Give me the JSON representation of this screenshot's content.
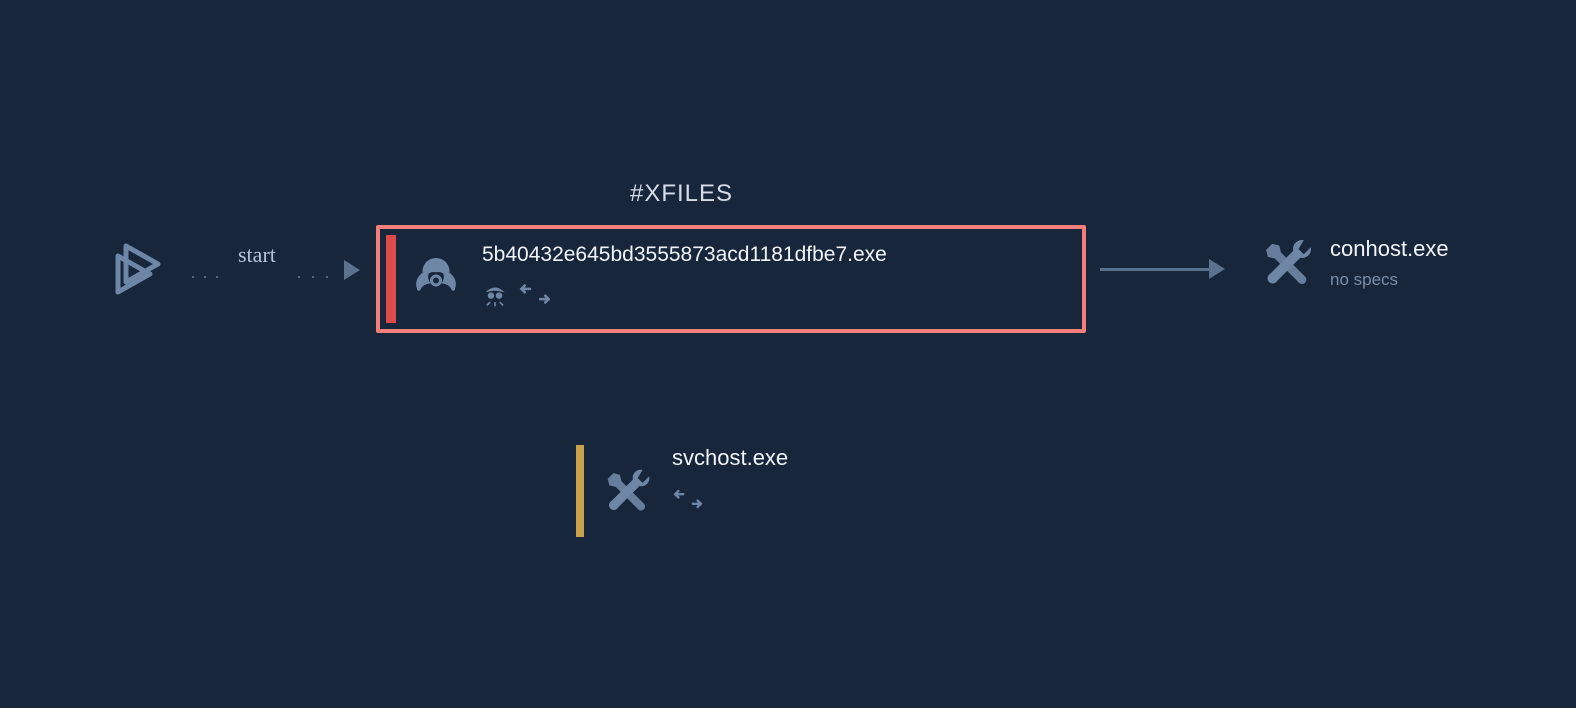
{
  "start": {
    "label": "start"
  },
  "nodes": {
    "main": {
      "tag": "#XFILES",
      "title": "5b40432e645bd3555873acd1181dfbe7.exe",
      "icon": "biohazard-icon",
      "indicators": [
        "stealth-icon",
        "network-icon"
      ],
      "stripe_color": "#dd4b4b",
      "border_color": "#f47f7a"
    },
    "right": {
      "title": "conhost.exe",
      "subtitle": "no specs",
      "icon": "tools-icon"
    },
    "bottom": {
      "title": "svchost.exe",
      "icon": "tools-icon",
      "indicators": [
        "network-icon"
      ],
      "stripe_color": "#c9a24c"
    }
  }
}
